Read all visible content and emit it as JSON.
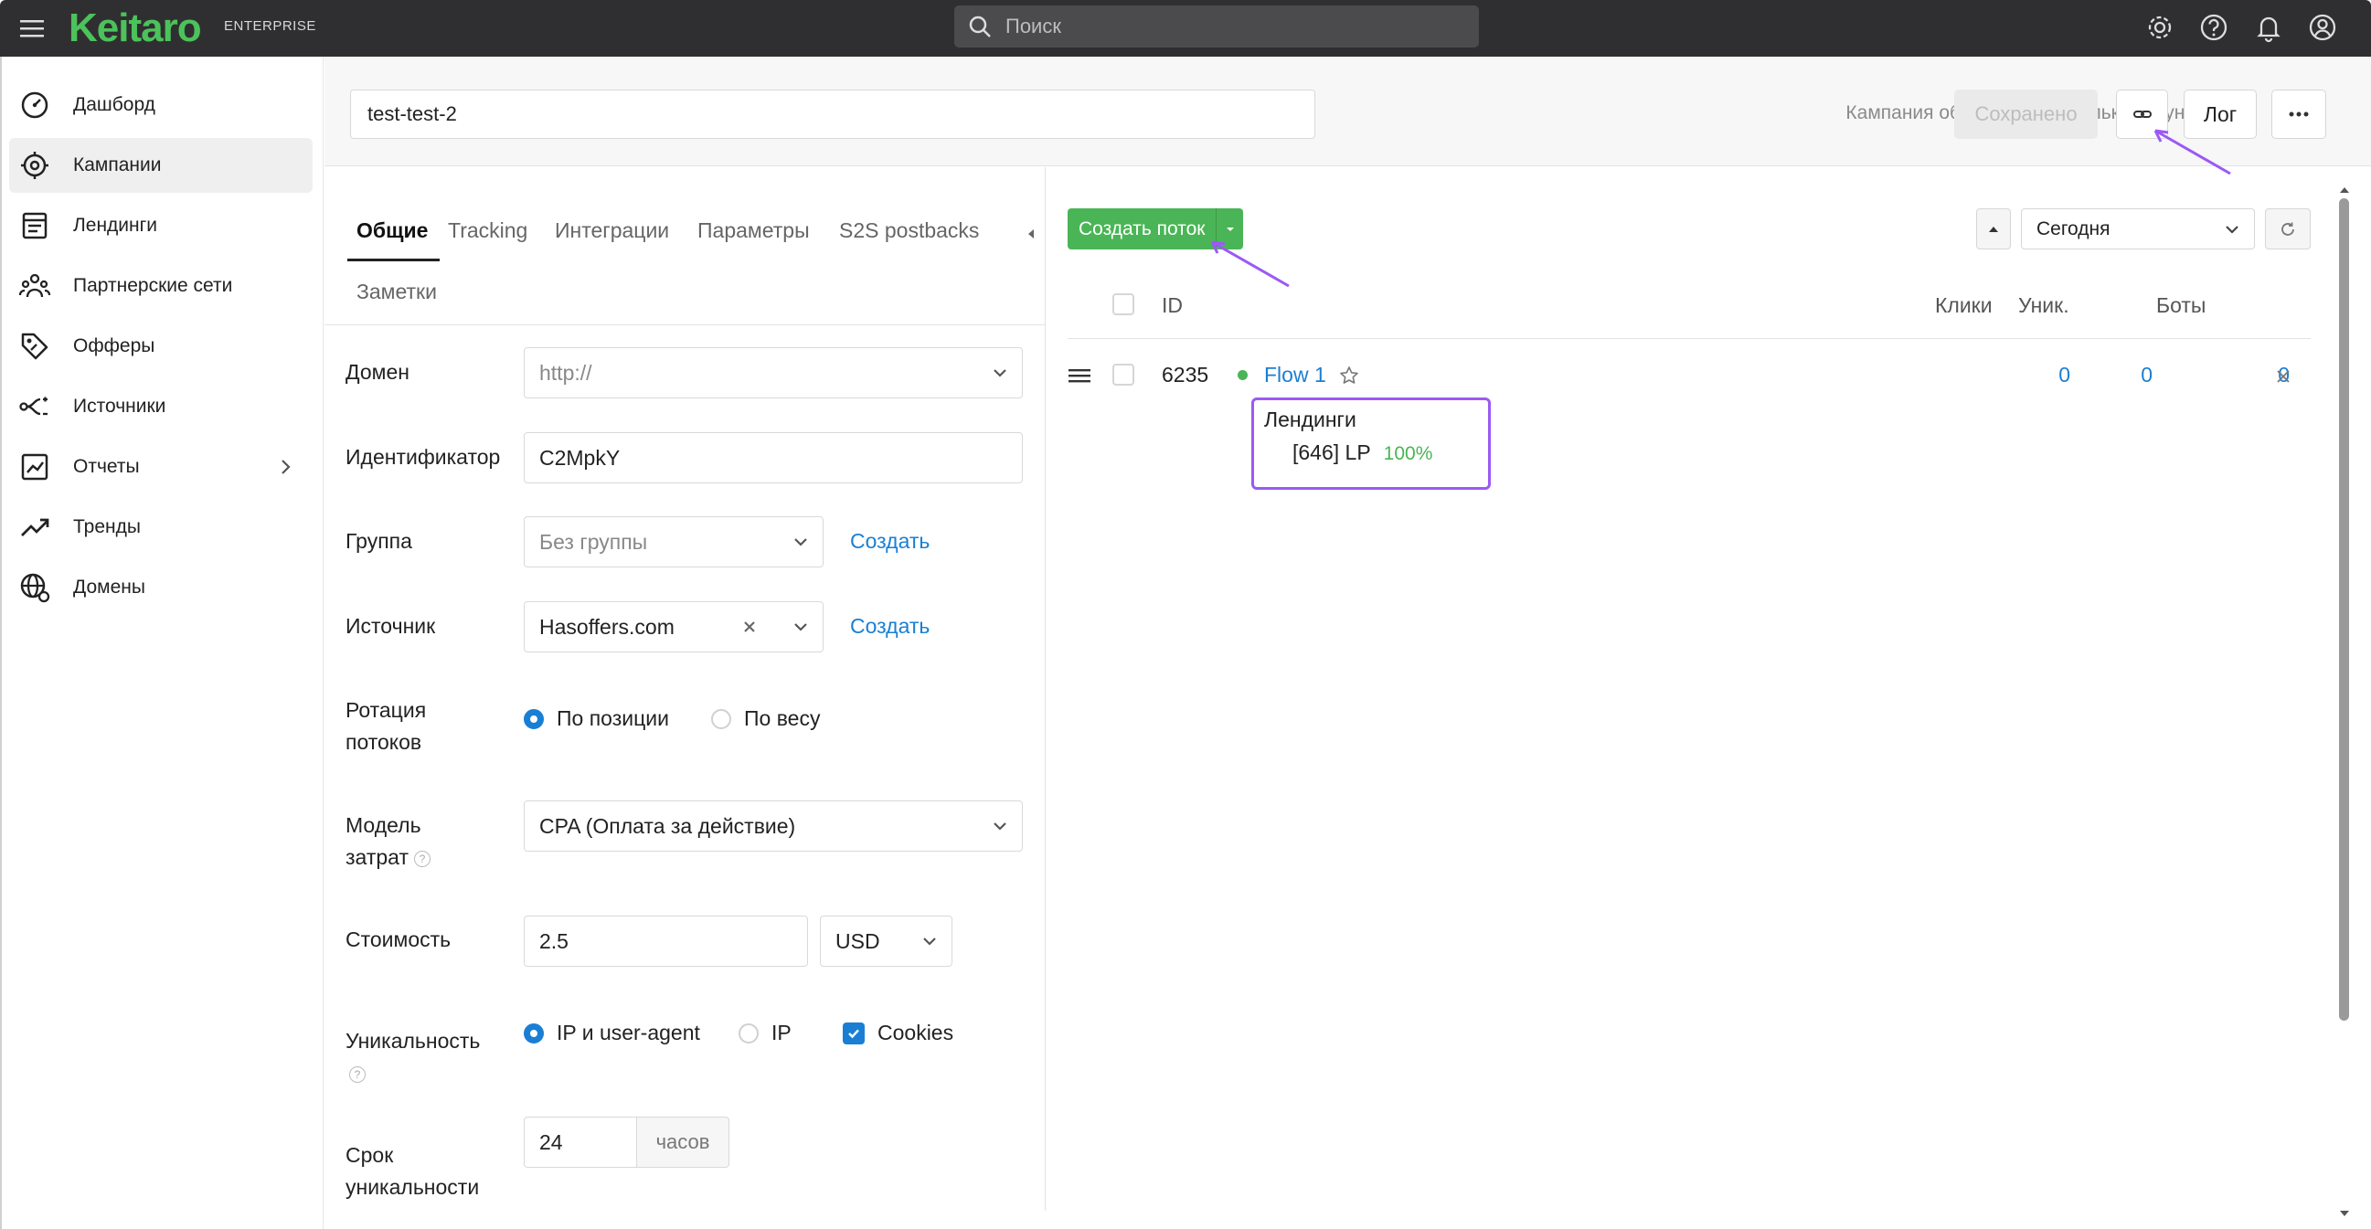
{
  "topbar": {
    "brand": "Keitaro",
    "brand_edition": "ENTERPRISE",
    "search_placeholder": "Поиск",
    "icons": [
      "menu-icon",
      "gear-icon",
      "help-icon",
      "bell-icon",
      "user-icon"
    ]
  },
  "sidebar": {
    "items": [
      {
        "label": "Дашборд",
        "icon": "dashboard-icon"
      },
      {
        "label": "Кампании",
        "icon": "campaign-icon",
        "active": true
      },
      {
        "label": "Лендинги",
        "icon": "landing-icon"
      },
      {
        "label": "Партнерские сети",
        "icon": "partners-icon"
      },
      {
        "label": "Офферы",
        "icon": "offers-icon"
      },
      {
        "label": "Источники",
        "icon": "sources-icon"
      },
      {
        "label": "Отчеты",
        "icon": "reports-icon",
        "has_submenu": true
      },
      {
        "label": "Тренды",
        "icon": "trends-icon"
      },
      {
        "label": "Домены",
        "icon": "domains-icon"
      }
    ]
  },
  "header": {
    "campaign_name": "test-test-2",
    "status_text": "Кампания обновлена несколько секунд назад",
    "saved_label": "Сохранено",
    "log_label": "Лог"
  },
  "form": {
    "tabs": [
      "Общие",
      "Tracking",
      "Интеграции",
      "Параметры",
      "S2S postbacks",
      "Заметки"
    ],
    "domain": {
      "label": "Домен",
      "placeholder": "http://"
    },
    "identifier": {
      "label": "Идентификатор",
      "value": "C2MpkY"
    },
    "group": {
      "label": "Группа",
      "value": "Без группы",
      "create": "Создать"
    },
    "source": {
      "label": "Источник",
      "value": "Hasoffers.com",
      "create": "Создать"
    },
    "rotation": {
      "label_1": "Ротация",
      "label_2": "потоков",
      "options": [
        "По позиции",
        "По весу"
      ],
      "selected": "По позиции"
    },
    "cost_model": {
      "label_1": "Модель",
      "label_2": "затрат",
      "value": "CPA (Оплата за действие)"
    },
    "cost": {
      "label": "Стоимость",
      "value": "2.5",
      "currency": "USD"
    },
    "uniqueness": {
      "label": "Уникальность",
      "options": [
        "IP и user-agent",
        "IP"
      ],
      "selected": "IP и user-agent",
      "cookies_label": "Cookies",
      "cookies_checked": true
    },
    "uniqueness_period": {
      "label_1": "Срок",
      "label_2": "уникальности",
      "value": "24",
      "unit": "часов"
    }
  },
  "flows": {
    "create_label": "Создать поток",
    "date_range": "Сегодня",
    "columns": [
      "ID",
      "Клики",
      "Уник.",
      "Боты"
    ],
    "rows": [
      {
        "id": "6235",
        "name": "Flow 1",
        "clicks": "0",
        "unique": "0",
        "bots": "0"
      }
    ],
    "popover": {
      "title": "Лендинги",
      "item": "[646] LP",
      "share": "100%"
    }
  },
  "colors": {
    "accent_green": "#4ab556",
    "link_blue": "#1a7fd4",
    "annotation_purple": "#9b59f5",
    "topbar": "#2f2f31"
  }
}
